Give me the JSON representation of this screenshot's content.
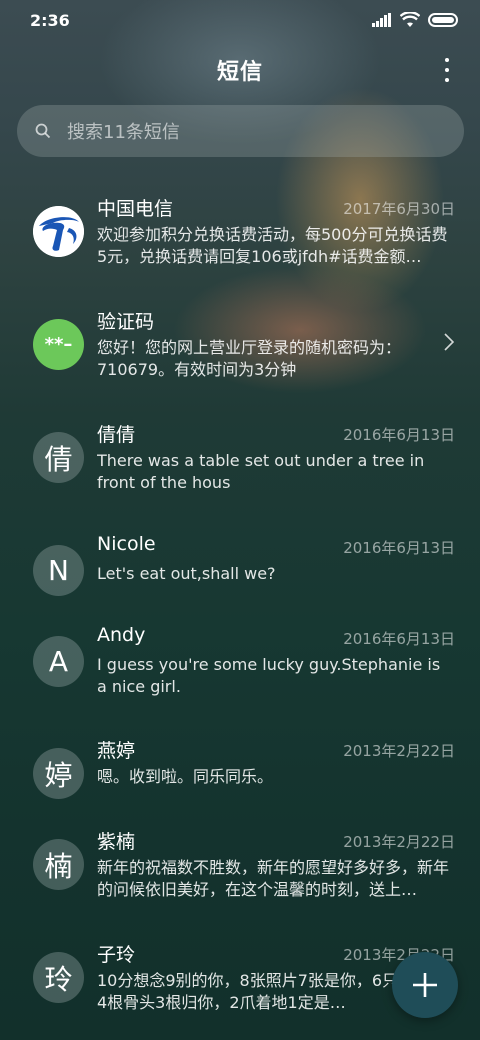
{
  "status_bar": {
    "time": "2:36"
  },
  "header": {
    "title": "短信"
  },
  "search": {
    "placeholder": "搜索11条短信"
  },
  "conversations": [
    {
      "name": "中国电信",
      "date": "2017年6月30日",
      "preview": "欢迎参加积分兑换话费活动，每500分可兑换话费5元，兑换话费请回复106或jfdh#话费金额…",
      "avatar": "telecom-logo"
    },
    {
      "name": "验证码",
      "date": "",
      "preview": "您好！您的网上营业厅登录的随机密码为：710679。有效时间为3分钟",
      "avatar_text": "**–",
      "avatar_color": "#6cc85a"
    },
    {
      "name": "倩倩",
      "date": "2016年6月13日",
      "preview": "There was a table set out under a tree in front of the hous",
      "avatar_text": "倩"
    },
    {
      "name": "Nicole",
      "date": "2016年6月13日",
      "preview": "Let's eat out,shall we?",
      "avatar_text": "N"
    },
    {
      "name": "Andy",
      "date": "2016年6月13日",
      "preview": "I guess you're some lucky guy.Stephanie is a nice girl.",
      "avatar_text": "A"
    },
    {
      "name": "燕婷",
      "date": "2013年2月22日",
      "preview": "嗯。收到啦。同乐同乐。",
      "avatar_text": "婷"
    },
    {
      "name": "紫楠",
      "date": "2013年2月22日",
      "preview": "新年的祝福数不胜数，新年的愿望好多好多，新年的问候依旧美好，在这个温馨的时刻，送上…",
      "avatar_text": "楠"
    },
    {
      "name": "子玲",
      "date": "2013年2月22日",
      "preview": "10分想念9别的你，8张照片7张是你，6只像你，4根骨头3根归你，2爪着地1定是…",
      "avatar_text": "玲"
    }
  ],
  "fab": {
    "icon": "plus-icon"
  }
}
